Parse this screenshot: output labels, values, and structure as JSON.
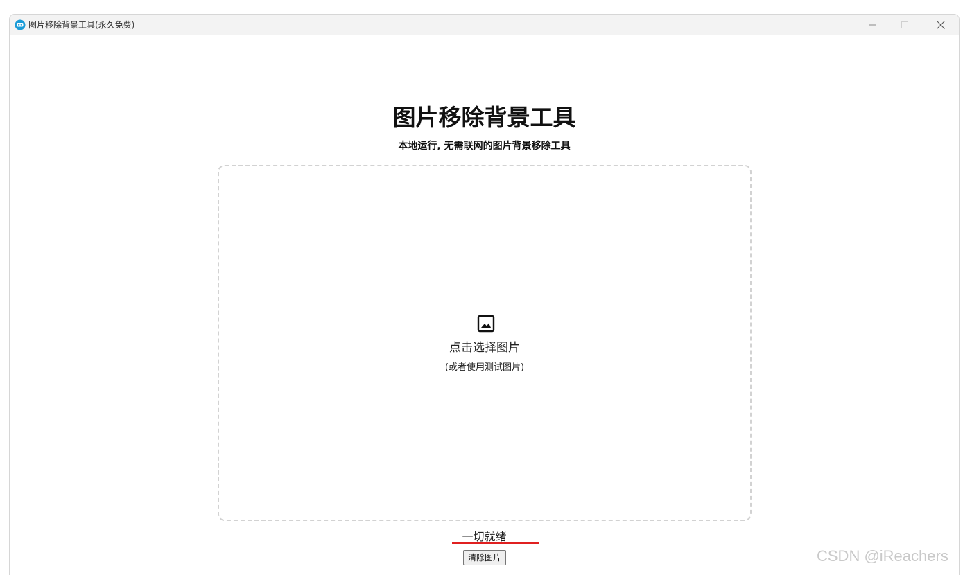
{
  "window": {
    "title": "图片移除背景工具(永久免费)",
    "icon": "app-logo-icon",
    "controls": {
      "minimize": "minimize-icon",
      "maximize": "maximize-icon",
      "close": "close-icon"
    }
  },
  "header": {
    "title": "图片移除背景工具",
    "subtitle": "本地运行, 无需联网的图片背景移除工具"
  },
  "dropzone": {
    "icon": "image-icon",
    "label": "点击选择图片",
    "alt_open": "(",
    "alt_link": "或者使用测试图片",
    "alt_close": ")"
  },
  "status": {
    "text": "一切就绪",
    "underline_color": "#e02020"
  },
  "actions": {
    "clear_label": "清除图片"
  },
  "watermark": "CSDN @iReachers"
}
